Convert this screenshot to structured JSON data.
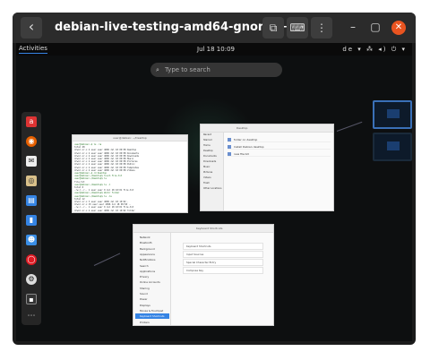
{
  "window": {
    "title": "debian-live-testing-amd64-gnome+...",
    "back_icon": "‹",
    "screenshot_icon": "⧉",
    "keyboard_icon": "⌨",
    "menu_icon": "⋮",
    "minimize_icon": "–",
    "maximize_icon": "▢",
    "close_icon": "✕"
  },
  "gnome": {
    "activities": "Activities",
    "clock": "Jul 18  10:09",
    "tray": "de ▾  ⁂ ◂) ⏻ ▾",
    "search_placeholder": "Type to search",
    "search_icon": "🔍"
  },
  "dash": {
    "icons": [
      "a",
      "◉",
      "✉",
      "◎",
      "▤",
      "▮",
      "☻",
      "⚙",
      "◯",
      "▪"
    ],
    "grid_icon": "⋮⋮⋮"
  },
  "windows": {
    "terminal_title": "user@debian: ~/Desktop",
    "terminal_lines": [
      "user@debian:~$ ls -la",
      "total 48",
      "drwxr-xr-x 2 user user 4096 Jul 18 09:58 Desktop",
      "drwxr-xr-x 2 user user 4096 Jul 18 09:58 Documents",
      "drwxr-xr-x 2 user user 4096 Jul 18 09:58 Downloads",
      "drwxr-xr-x 2 user user 4096 Jul 18 09:58 Music",
      "drwxr-xr-x 2 user user 4096 Jul 18 09:58 Pictures",
      "drwxr-xr-x 2 user user 4096 Jul 18 09:58 Public",
      "drwxr-xr-x 2 user user 4096 Jul 18 09:58 Templates",
      "drwxr-xr-x 2 user user 4096 Jul 18 09:58 Videos",
      "user@debian:~$ cd Desktop",
      "user@debian:~/Desktop$ touch file.txt",
      "user@debian:~/Desktop$ ls",
      "file.txt",
      "user@debian:~/Desktop$ ls -l",
      "total 0",
      "-rw-r--r-- 1 user user 0 Jul 18 10:01 file.txt",
      "user@debian:~/Desktop$ mkdir folder",
      "user@debian:~/Desktop$ ls -la",
      "total 12",
      "drwxr-xr-x 3 user user 4096 Jul 18 10:02 .",
      "drwxr-xr-x 15 user user 4096 Jul 18 09:58 ..",
      "-rw-r--r-- 1 user user 0 Jul 18 10:01 file.txt",
      "drwxr-xr-x 2 user user 4096 Jul 18 10:02 folder",
      "user@debian:~/Desktop$"
    ],
    "files_title": "Desktop",
    "files_rows": [
      "folder on desktop",
      "Install Debian desktop",
      "new file.txt"
    ],
    "files_sidebar": [
      "Recent",
      "Starred",
      "Home",
      "Desktop",
      "Documents",
      "Downloads",
      "Music",
      "Pictures",
      "Videos",
      "Trash",
      "Other Locations"
    ],
    "settings_title": "Keyboard Shortcuts",
    "settings_items": [
      "Network",
      "Bluetooth",
      "Background",
      "Appearance",
      "Notifications",
      "Search",
      "Applications",
      "Privacy",
      "Online Accounts",
      "Sharing",
      "Sound",
      "Power",
      "Displays",
      "Mouse & Touchpad",
      "Keyboard Shortcuts",
      "Printers"
    ],
    "settings_cards": [
      "Keyboard Shortcuts",
      "Input Sources",
      "Special Character Entry",
      "Compose Key"
    ]
  }
}
